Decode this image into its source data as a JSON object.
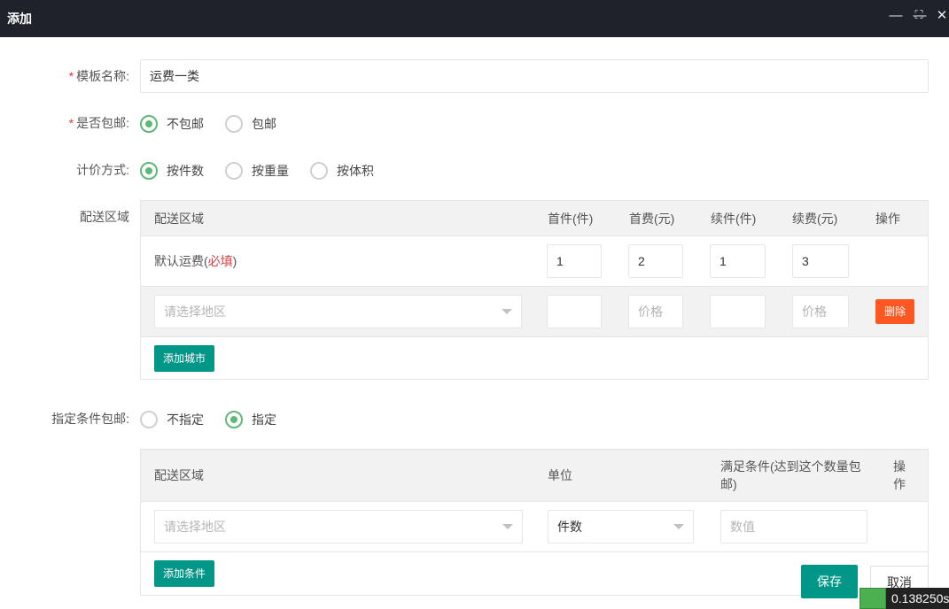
{
  "titlebar": {
    "title": "添加",
    "minimize_icon": "—",
    "maximize_icon": "⛶",
    "close_icon": "✕"
  },
  "form": {
    "template_name": {
      "required_mark": "*",
      "label": "模板名称:",
      "value": "运费一类"
    },
    "free_shipping": {
      "required_mark": "*",
      "label": "是否包邮:",
      "options": [
        {
          "label": "不包邮",
          "checked": true
        },
        {
          "label": "包邮",
          "checked": false
        }
      ]
    },
    "pricing_method": {
      "label": "计价方式:",
      "options": [
        {
          "label": "按件数",
          "checked": true
        },
        {
          "label": "按重量",
          "checked": false
        },
        {
          "label": "按体积",
          "checked": false
        }
      ]
    },
    "delivery_area": {
      "label": "配送区域",
      "table": {
        "headers": [
          "配送区域",
          "首件(件)",
          "首费(元)",
          "续件(件)",
          "续费(元)",
          "操作"
        ],
        "default_row": {
          "area_label": "默认运费(",
          "area_required": "必填",
          "area_close": ")",
          "first_item": "1",
          "first_fee": "2",
          "extra_item": "1",
          "extra_fee": "3"
        },
        "region_row": {
          "select_placeholder": "请选择地区",
          "first_fee_placeholder": "价格",
          "extra_fee_placeholder": "价格",
          "delete_label": "删除"
        },
        "add_city_label": "添加城市"
      }
    },
    "conditional_free": {
      "label": "指定条件包邮:",
      "options": [
        {
          "label": "不指定",
          "checked": false
        },
        {
          "label": "指定",
          "checked": true
        }
      ],
      "table": {
        "headers": [
          "配送区域",
          "单位",
          "满足条件(达到这个数量包邮)",
          "操作"
        ],
        "row": {
          "select_placeholder": "请选择地区",
          "unit_value": "件数",
          "value_placeholder": "数值"
        },
        "add_condition_label": "添加条件"
      }
    }
  },
  "footer": {
    "save_label": "保存",
    "cancel_label": "取消",
    "timer_text": "0.138250s"
  },
  "colors": {
    "titlebar_bg": "#1f222b",
    "primary_green": "#009688",
    "radio_green": "#5fb878",
    "danger_orange": "#ff5722",
    "required_red": "#e4393c"
  }
}
